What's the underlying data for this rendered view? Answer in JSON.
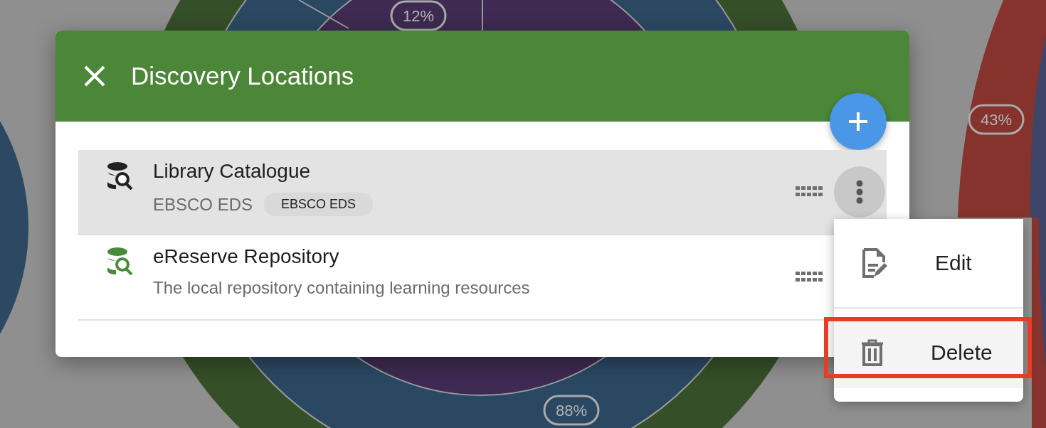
{
  "background": {
    "labels": [
      "12%",
      "43%",
      "88%"
    ]
  },
  "dialog": {
    "title": "Discovery Locations",
    "items": [
      {
        "title": "Library Catalogue",
        "subtitle": "EBSCO EDS",
        "chip": "EBSCO EDS",
        "color": "#222222",
        "selected": true
      },
      {
        "title": "eReserve Repository",
        "subtitle": "The local repository containing learning resources",
        "color": "#4a8a3a",
        "selected": false
      }
    ]
  },
  "menu": {
    "items": [
      {
        "kind": "edit",
        "label": "Edit",
        "hovered": false,
        "callout": false
      },
      {
        "kind": "delete",
        "label": "Delete",
        "hovered": true,
        "callout": true
      }
    ]
  }
}
